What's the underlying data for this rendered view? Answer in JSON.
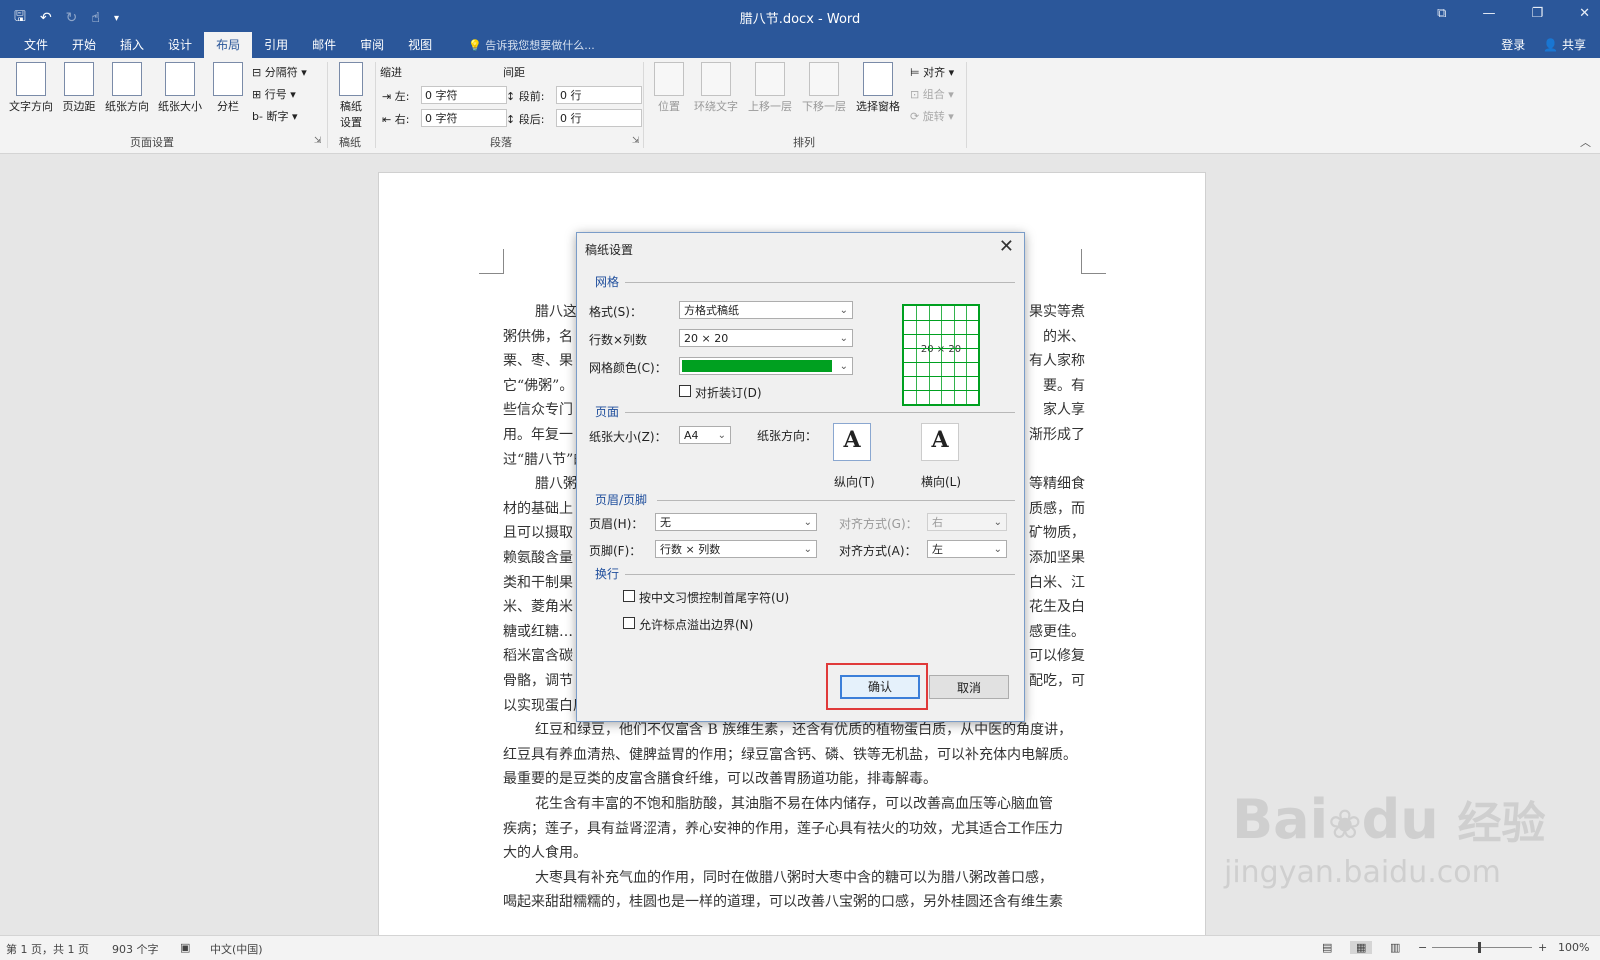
{
  "window": {
    "title": "腊八节.docx - Word"
  },
  "menu": {
    "tabs": [
      "文件",
      "开始",
      "插入",
      "设计",
      "布局",
      "引用",
      "邮件",
      "审阅",
      "视图"
    ],
    "active_tab": "布局",
    "tell_me": "告诉我您想要做什么...",
    "login": "登录",
    "share": "共享"
  },
  "ribbon": {
    "page_setup": {
      "text_direction": "文字方向",
      "margins": "页边距",
      "orientation": "纸张方向",
      "size": "纸张大小",
      "columns": "分栏",
      "breaks": "分隔符",
      "line_numbers": "行号",
      "hyphenation": "断字",
      "group_label": "页面设置"
    },
    "manuscript": {
      "button": "稿纸设置",
      "button_line1": "稿纸",
      "button_line2": "设置",
      "group_label": "稿纸"
    },
    "paragraph": {
      "indent_title": "缩进",
      "spacing_title": "间距",
      "left_label": "左:",
      "left_value": "0 字符",
      "right_label": "右:",
      "right_value": "0 字符",
      "before_label": "段前:",
      "before_value": "0 行",
      "after_label": "段后:",
      "after_value": "0 行",
      "group_label": "段落"
    },
    "arrange": {
      "position": "位置",
      "wrap_text": "环绕文字",
      "bring_forward": "上移一层",
      "send_backward": "下移一层",
      "selection_pane": "选择窗格",
      "align": "对齐",
      "group": "组合",
      "rotate": "旋转",
      "group_label": "排列"
    }
  },
  "document": {
    "lines": [
      "腊八这",
      "粥供佛，名",
      "栗、枣、果",
      "它“佛粥”。",
      "些信众专门",
      "用。年复一",
      "过“腊八节”的",
      "腊八粥",
      "材的基础上",
      "且可以摄取",
      "赖氨酸含量",
      "类和干制果",
      "米、菱角米",
      "糖或红糖…",
      "稻米富含碳",
      "骨骼，调节",
      "以实现蛋白质互补，让氨基酸构成更加均衡。",
      "红豆和绿豆，他们不仅富含 B 族维生素，还含有优质的植物蛋白质，从中医的角度讲，",
      "红豆具有养血清热、健脾益胃的作用；绿豆富含钙、磷、铁等无机盐，可以补充体内电解质。",
      "最重要的是豆类的皮富含膳食纤维，可以改善胃肠道功能，排毒解毒。",
      "花生含有丰富的不饱和脂肪酸，其油脂不易在体内储存，可以改善高血压等心脑血管",
      "疾病；莲子，具有益肾涩清，养心安神的作用，莲子心具有祛火的功效，尤其适合工作压力",
      "大的人食用。",
      "大枣具有补充气血的作用，同时在做腊八粥时大枣中含的糖可以为腊八粥改善口感，",
      "喝起来甜甜糯糯的，桂圆也是一样的道理，可以改善八宝粥的口感，另外桂圆还含有维生素"
    ],
    "right_fragments": [
      "果实等煮",
      "的米、",
      "有人家称",
      "要。有",
      "家人享",
      "渐形成了",
      "等精细食",
      "质感，而",
      "矿物质，",
      "添加坚果",
      "白米、江",
      "花生及白",
      "感更佳。",
      "可以修复",
      "配吃，可"
    ]
  },
  "dialog": {
    "title": "稿纸设置",
    "grid_section": "网格",
    "format_label": "格式(S)：",
    "format_value": "方格式稿纸",
    "rows_cols_label": "行数×列数",
    "rows_cols_value": "20 × 20",
    "grid_color_label": "网格颜色(C)：",
    "grid_color": "#00a020",
    "fold_binding_label": "对折装订(D)",
    "preview_text": "20 × 20",
    "page_section": "页面",
    "paper_size_label": "纸张大小(Z)：",
    "paper_size_value": "A4",
    "orientation_label": "纸张方向：",
    "portrait_label": "纵向(T)",
    "landscape_label": "横向(L)",
    "header_footer_section": "页眉/页脚",
    "header_label": "页眉(H)：",
    "header_value": "无",
    "header_align_label": "对齐方式(G)：",
    "header_align_value": "右",
    "footer_label": "页脚(F)：",
    "footer_value": "行数 × 列数",
    "footer_align_label": "对齐方式(A)：",
    "footer_align_value": "左",
    "line_break_section": "换行",
    "option1_label": "按中文习惯控制首尾字符(U)",
    "option2_label": "允许标点溢出边界(N)",
    "ok_label": "确认",
    "cancel_label": "取消"
  },
  "status": {
    "page": "第 1 页，共 1 页",
    "words": "903 个字",
    "language": "中文(中国)",
    "zoom": "100%"
  },
  "watermark": {
    "brand": "Bai",
    "brand2": "du",
    "cn": "经验",
    "url": "jingyan.baidu.com"
  }
}
